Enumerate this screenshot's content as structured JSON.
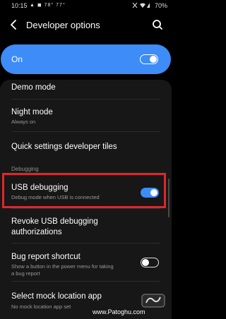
{
  "status_bar": {
    "time": "10:15",
    "left_icons": "▲ ◼ 78° 77°",
    "right_icons": "🔇 ◢",
    "battery": "70%",
    "icon_names": [
      "notification-icon",
      "weather-icon",
      "mute-icon",
      "wifi-icon",
      "signal-icon",
      "battery-icon"
    ]
  },
  "appbar": {
    "title": "Developer options",
    "back_icon": "back-arrow-icon",
    "search_icon": "search-icon"
  },
  "master_switch": {
    "label": "On",
    "state": true
  },
  "items": [
    {
      "title": "Demo mode",
      "subtitle": ""
    },
    {
      "title": "Night mode",
      "subtitle": "Always on"
    },
    {
      "title": "Quick settings developer tiles",
      "subtitle": ""
    },
    {
      "title": "USB debugging",
      "subtitle": "Debug mode when USB is connected",
      "toggle": true
    },
    {
      "title": "Revoke USB debugging",
      "title2": "authorizations",
      "subtitle": ""
    },
    {
      "title": "Bug report shortcut",
      "subtitle": "Show a button in the power menu for taking",
      "subtitle2": "a bug report",
      "toggle": false
    },
    {
      "title": "Select mock location app",
      "subtitle": "No mock location app set"
    }
  ],
  "section_debugging": "Debugging",
  "watermark": {
    "text": "www.Patoghu.com"
  },
  "colors": {
    "accent": "#3d8cf7",
    "highlight_border": "#e0262b",
    "background": "#000000",
    "card": "#171717"
  }
}
